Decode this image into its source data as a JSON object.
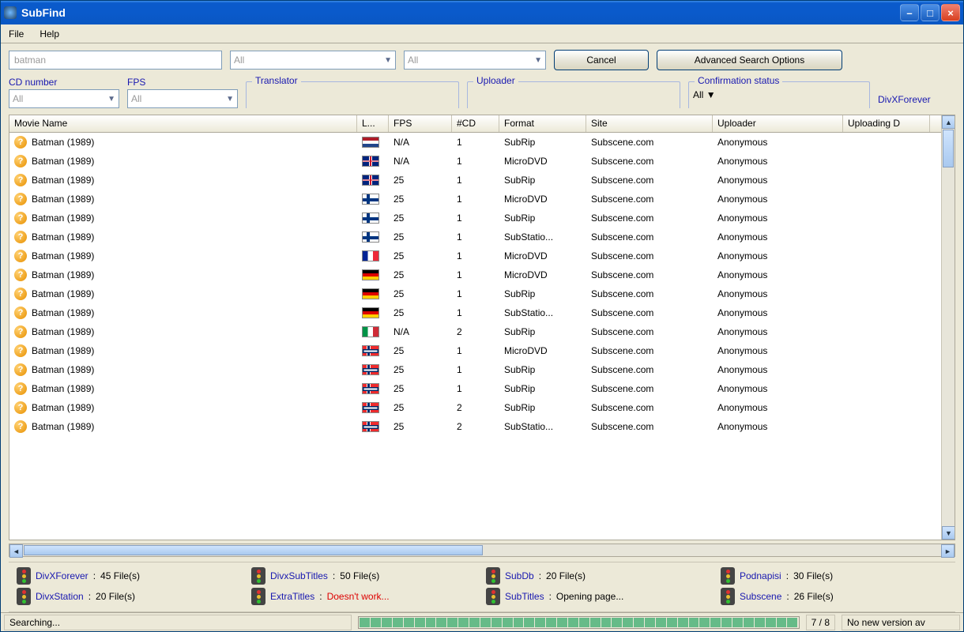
{
  "window": {
    "title": "SubFind"
  },
  "menu": {
    "file": "File",
    "help": "Help"
  },
  "toolbar": {
    "search_value": "batman",
    "combo1": "All",
    "combo2": "All",
    "cancel": "Cancel",
    "advanced": "Advanced Search Options"
  },
  "filters": {
    "cd_label": "CD number",
    "cd_value": "All",
    "fps_label": "FPS",
    "fps_value": "All",
    "translator_label": "Translator",
    "translator_value": "",
    "uploader_label": "Uploader",
    "uploader_value": "",
    "confirm_label": "Confirmation status",
    "confirm_value": "All",
    "tab_link": "DivXForever"
  },
  "columns": {
    "name": "Movie Name",
    "lang": "L...",
    "fps": "FPS",
    "cd": "#CD",
    "format": "Format",
    "site": "Site",
    "uploader": "Uploader",
    "updf": "Uploading D"
  },
  "rows": [
    {
      "name": "Batman (1989)",
      "flag": "nl",
      "fps": "N/A",
      "cd": "1",
      "format": "SubRip",
      "site": "Subscene.com",
      "uploader": "Anonymous"
    },
    {
      "name": "Batman (1989)",
      "flag": "gb",
      "fps": "N/A",
      "cd": "1",
      "format": "MicroDVD",
      "site": "Subscene.com",
      "uploader": "Anonymous"
    },
    {
      "name": "Batman (1989)",
      "flag": "gb",
      "fps": "25",
      "cd": "1",
      "format": "SubRip",
      "site": "Subscene.com",
      "uploader": "Anonymous"
    },
    {
      "name": "Batman (1989)",
      "flag": "fi",
      "fps": "25",
      "cd": "1",
      "format": "MicroDVD",
      "site": "Subscene.com",
      "uploader": "Anonymous"
    },
    {
      "name": "Batman (1989)",
      "flag": "fi",
      "fps": "25",
      "cd": "1",
      "format": "SubRip",
      "site": "Subscene.com",
      "uploader": "Anonymous"
    },
    {
      "name": "Batman (1989)",
      "flag": "fi",
      "fps": "25",
      "cd": "1",
      "format": "SubStatio...",
      "site": "Subscene.com",
      "uploader": "Anonymous"
    },
    {
      "name": "Batman (1989)",
      "flag": "fr",
      "fps": "25",
      "cd": "1",
      "format": "MicroDVD",
      "site": "Subscene.com",
      "uploader": "Anonymous"
    },
    {
      "name": "Batman (1989)",
      "flag": "de",
      "fps": "25",
      "cd": "1",
      "format": "MicroDVD",
      "site": "Subscene.com",
      "uploader": "Anonymous"
    },
    {
      "name": "Batman (1989)",
      "flag": "de",
      "fps": "25",
      "cd": "1",
      "format": "SubRip",
      "site": "Subscene.com",
      "uploader": "Anonymous"
    },
    {
      "name": "Batman (1989)",
      "flag": "de",
      "fps": "25",
      "cd": "1",
      "format": "SubStatio...",
      "site": "Subscene.com",
      "uploader": "Anonymous"
    },
    {
      "name": "Batman (1989)",
      "flag": "it",
      "fps": "N/A",
      "cd": "2",
      "format": "SubRip",
      "site": "Subscene.com",
      "uploader": "Anonymous"
    },
    {
      "name": "Batman (1989)",
      "flag": "no",
      "fps": "25",
      "cd": "1",
      "format": "MicroDVD",
      "site": "Subscene.com",
      "uploader": "Anonymous"
    },
    {
      "name": "Batman (1989)",
      "flag": "no",
      "fps": "25",
      "cd": "1",
      "format": "SubRip",
      "site": "Subscene.com",
      "uploader": "Anonymous"
    },
    {
      "name": "Batman (1989)",
      "flag": "no",
      "fps": "25",
      "cd": "1",
      "format": "SubRip",
      "site": "Subscene.com",
      "uploader": "Anonymous"
    },
    {
      "name": "Batman (1989)",
      "flag": "no",
      "fps": "25",
      "cd": "2",
      "format": "SubRip",
      "site": "Subscene.com",
      "uploader": "Anonymous"
    },
    {
      "name": "Batman (1989)",
      "flag": "no",
      "fps": "25",
      "cd": "2",
      "format": "SubStatio...",
      "site": "Subscene.com",
      "uploader": "Anonymous"
    }
  ],
  "sites": [
    {
      "name": "DivXForever",
      "sep": " : ",
      "status": "45 File(s)",
      "err": false
    },
    {
      "name": "DivxSubTitles",
      "sep": " : ",
      "status": "50 File(s)",
      "err": false
    },
    {
      "name": "SubDb",
      "sep": " : ",
      "status": "20 File(s)",
      "err": false
    },
    {
      "name": "Podnapisi",
      "sep": " : ",
      "status": "30 File(s)",
      "err": false
    },
    {
      "name": "DivxStation",
      "sep": " : ",
      "status": "20 File(s)",
      "err": false
    },
    {
      "name": "ExtraTitles",
      "sep": " : ",
      "status": "Doesn't work...",
      "err": true
    },
    {
      "name": "SubTitles",
      "sep": " : ",
      "status": "Opening page...",
      "err": false
    },
    {
      "name": "Subscene",
      "sep": " : ",
      "status": "26 File(s)",
      "err": false
    }
  ],
  "statusbar": {
    "left": "Searching...",
    "counter": "7 / 8",
    "version": "No new version av"
  }
}
